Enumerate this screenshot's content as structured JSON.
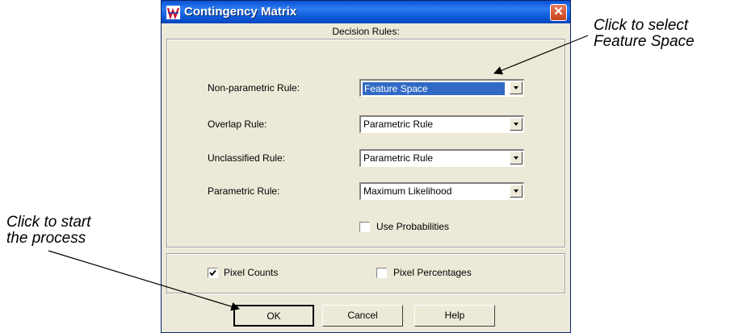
{
  "window": {
    "title": "Contingency Matrix",
    "close_glyph": "✕"
  },
  "header": {
    "label": "Decision Rules:"
  },
  "rules": [
    {
      "label": "Non-parametric Rule:",
      "value": "Feature Space",
      "selected": true
    },
    {
      "label": "Overlap Rule:",
      "value": "Parametric Rule",
      "selected": false
    },
    {
      "label": "Unclassified Rule:",
      "value": "Parametric Rule",
      "selected": false
    },
    {
      "label": "Parametric Rule:",
      "value": "Maximum Likelihood",
      "selected": false
    }
  ],
  "options": {
    "use_probabilities": {
      "label": "Use Probabilities",
      "checked": false
    },
    "pixel_counts": {
      "label": "Pixel Counts",
      "checked": true
    },
    "pixel_percentages": {
      "label": "Pixel Percentages",
      "checked": false
    }
  },
  "buttons": {
    "ok": "OK",
    "cancel": "Cancel",
    "help": "Help"
  },
  "annotations": {
    "select_line1": "Click to select",
    "select_line2": "Feature Space",
    "start_line1": "Click to start",
    "start_line2": "the process"
  },
  "colors": {
    "titlebar": "#0a52d6",
    "selection": "#316ac5",
    "dialog_bg": "#ece9d8",
    "close": "#c9411f"
  },
  "icons": [
    "app-icon",
    "close-icon",
    "dropdown-arrow-icon",
    "checkmark-icon"
  ]
}
